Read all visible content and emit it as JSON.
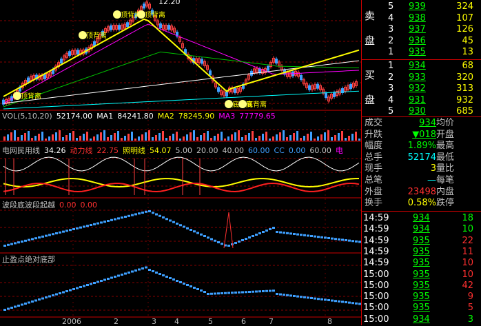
{
  "price_chart": {
    "top_price": "12.20",
    "bubbles": [
      "顶背离",
      "顶背离",
      "顶背离",
      "顶背离",
      "底背离",
      "底背离"
    ]
  },
  "vol_row": [
    {
      "text": "VOL(5,10,20)",
      "color": "#c0c0c0"
    },
    {
      "text": "52174.00",
      "color": "#ffffff"
    },
    {
      "text": "MA1",
      "color": "#ffffff"
    },
    {
      "text": "84241.80",
      "color": "#ffffff"
    },
    {
      "text": "MA2",
      "color": "#ffff00"
    },
    {
      "text": "78245.90",
      "color": "#ffff00"
    },
    {
      "text": "MA3",
      "color": "#ff00ff"
    },
    {
      "text": "77779.65",
      "color": "#ff00ff"
    }
  ],
  "ind_row": [
    {
      "text": "电网民用线",
      "color": "#c0c0c0"
    },
    {
      "text": "34.26",
      "color": "#ffffff"
    },
    {
      "text": "动力线",
      "color": "#ff3030"
    },
    {
      "text": "22.75",
      "color": "#ff3030"
    },
    {
      "text": "照明线",
      "color": "#ffff00"
    },
    {
      "text": "54.07",
      "color": "#ffff00"
    },
    {
      "text": "5.00",
      "color": "#c0c0c0"
    },
    {
      "text": "20.00",
      "color": "#c0c0c0"
    },
    {
      "text": "40.00",
      "color": "#c0c0c0"
    },
    {
      "text": "60.00",
      "color": "#3ea0ff"
    },
    {
      "text": "CC",
      "color": "#3ea0ff"
    },
    {
      "text": "0.00",
      "color": "#3ea0ff"
    },
    {
      "text": "60.00",
      "color": "#c0c0c0"
    },
    {
      "text": "电",
      "color": "#ff00ff"
    }
  ],
  "wave_row": [
    {
      "text": "波段底波段起越",
      "color": "#c0c0c0"
    },
    {
      "text": "0.00",
      "color": "#ff3030"
    },
    {
      "text": "0.00",
      "color": "#ff3030"
    }
  ],
  "stop_row": [
    {
      "text": "止盈点绝对底部",
      "color": "#c0c0c0"
    }
  ],
  "x_axis": [
    "2006",
    "2",
    "3",
    "4",
    "5",
    "6",
    "7",
    "8"
  ],
  "sell": {
    "label_top": "卖",
    "label_bottom": "盘",
    "rows": [
      {
        "n": "5",
        "price": "939",
        "vol": "324"
      },
      {
        "n": "4",
        "price": "938",
        "vol": "107"
      },
      {
        "n": "3",
        "price": "937",
        "vol": "126"
      },
      {
        "n": "2",
        "price": "936",
        "vol": "45"
      },
      {
        "n": "1",
        "price": "935",
        "vol": "13"
      }
    ]
  },
  "buy": {
    "label_top": "买",
    "label_bottom": "盘",
    "rows": [
      {
        "n": "1",
        "price": "934",
        "vol": "68"
      },
      {
        "n": "2",
        "price": "933",
        "vol": "320"
      },
      {
        "n": "3",
        "price": "932",
        "vol": "313"
      },
      {
        "n": "4",
        "price": "931",
        "vol": "932"
      },
      {
        "n": "5",
        "price": "930",
        "vol": "685"
      }
    ]
  },
  "stats": [
    {
      "l1": "成交",
      "v1": "934",
      "l2": "均价",
      "v2": ""
    },
    {
      "l1": "升跌",
      "v1": "▼018",
      "l2": "开盘",
      "v2": ""
    },
    {
      "l1": "幅度",
      "v1": "1.89%",
      "l2": "最高",
      "v2": ""
    },
    {
      "l1": "总手",
      "v1": "52174",
      "l2": "最低",
      "v2": ""
    },
    {
      "l1": "现手",
      "v1": "3",
      "l2": "量比",
      "v2": ""
    },
    {
      "l1": "总笔",
      "v1": "—",
      "l2": "每笔",
      "v2": ""
    },
    {
      "l1": "外盘",
      "v1": "23498",
      "l2": "内盘",
      "v2": ""
    },
    {
      "l1": "换手",
      "v1": "0.58%",
      "l2": "跌停",
      "v2": ""
    }
  ],
  "ticks": [
    {
      "time": "14:59",
      "price": "934",
      "vol": "18"
    },
    {
      "time": "14:59",
      "price": "934",
      "vol": "10"
    },
    {
      "time": "14:59",
      "price": "935",
      "vol": "22"
    },
    {
      "time": "14:59",
      "price": "935",
      "vol": "11"
    },
    {
      "time": "14:59",
      "price": "935",
      "vol": "10"
    },
    {
      "time": "15:00",
      "price": "935",
      "vol": "10"
    },
    {
      "time": "15:00",
      "price": "935",
      "vol": "42"
    },
    {
      "time": "15:00",
      "price": "935",
      "vol": "9"
    },
    {
      "time": "15:00",
      "price": "935",
      "vol": "5"
    },
    {
      "time": "15:00",
      "price": "934",
      "vol": "3"
    }
  ]
}
